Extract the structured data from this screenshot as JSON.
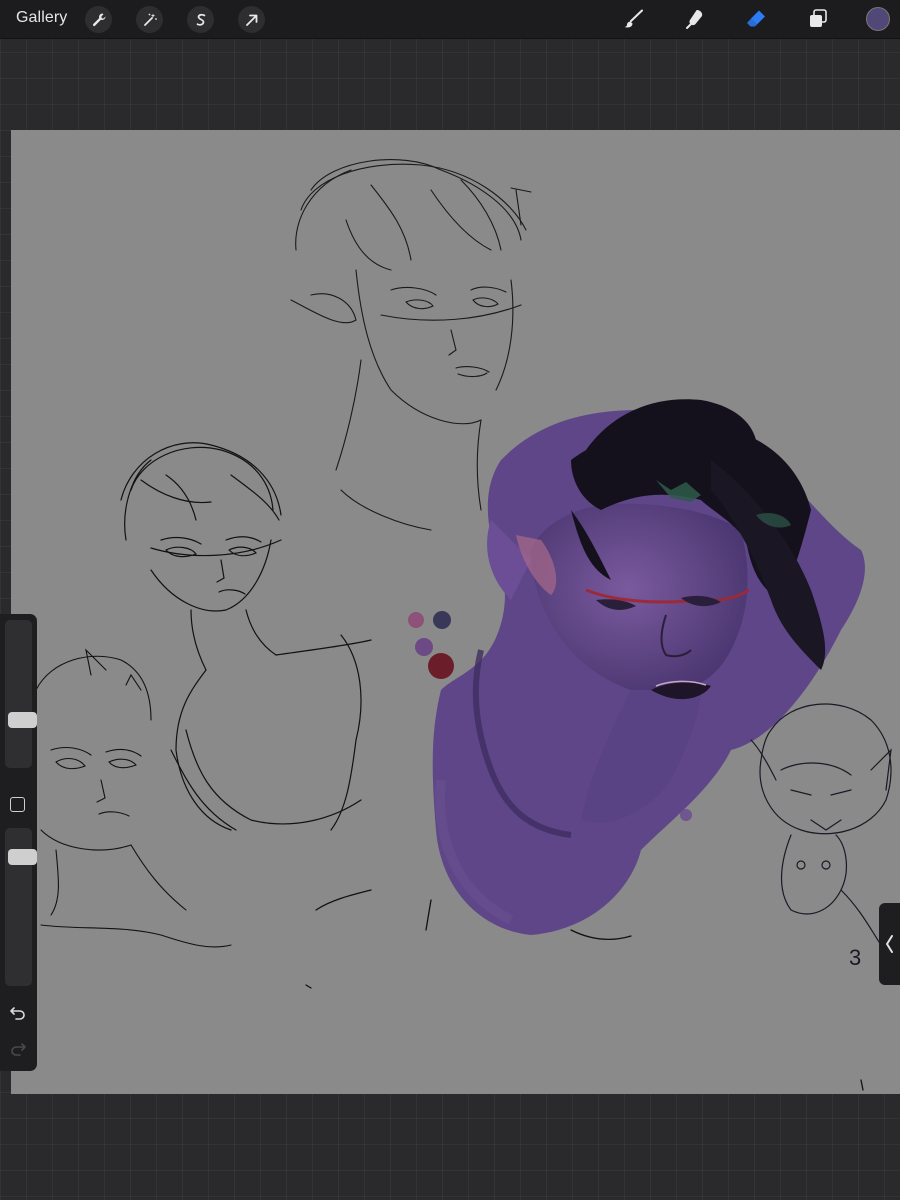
{
  "toolbar": {
    "gallery_label": "Gallery",
    "left_tools": [
      "wrench-icon",
      "magic-wand-icon",
      "selection-icon",
      "transform-arrow-icon"
    ],
    "right_tools": [
      "brush-icon",
      "smudge-icon",
      "eraser-icon",
      "layers-icon"
    ],
    "active_tool": "eraser-icon",
    "current_color": "#524878"
  },
  "sidebar": {
    "brush_size_level": 0.3,
    "opacity_level": 0.85,
    "tools": [
      "modify-square-icon",
      "undo-icon",
      "redo-icon"
    ]
  },
  "canvas": {
    "background_color": "#8a8a8a",
    "palette_swatches": [
      "#8e5278",
      "#3a3858",
      "#6d4a85",
      "#6b1e2a"
    ],
    "doodle_text": "3"
  },
  "colors": {
    "toolbar_bg": "#1c1c1e",
    "accent_blue": "#2b7cf5",
    "paint_purple": "#5e4688",
    "hair_dark": "#14111c"
  }
}
